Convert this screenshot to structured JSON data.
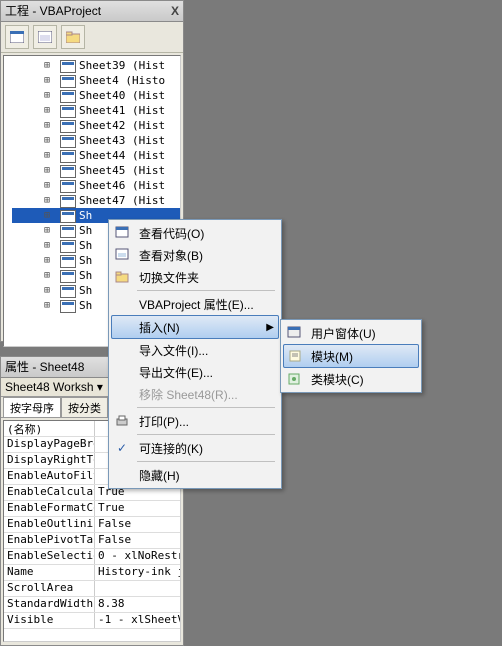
{
  "project_panel": {
    "title": "工程 - VBAProject",
    "close": "X",
    "tree": [
      {
        "label": "Sheet39 (Hist",
        "sel": false,
        "scroll": "^"
      },
      {
        "label": "Sheet4 (Histo",
        "sel": false
      },
      {
        "label": "Sheet40 (Hist",
        "sel": false
      },
      {
        "label": "Sheet41 (Hist",
        "sel": false
      },
      {
        "label": "Sheet42 (Hist",
        "sel": false
      },
      {
        "label": "Sheet43 (Hist",
        "sel": false
      },
      {
        "label": "Sheet44 (Hist",
        "sel": false
      },
      {
        "label": "Sheet45 (Hist",
        "sel": false
      },
      {
        "label": "Sheet46 (Hist",
        "sel": false
      },
      {
        "label": "Sheet47 (Hist",
        "sel": false
      },
      {
        "label": "Sh",
        "sel": true
      },
      {
        "label": "Sh",
        "sel": false
      },
      {
        "label": "Sh",
        "sel": false
      },
      {
        "label": "Sh",
        "sel": false
      },
      {
        "label": "Sh",
        "sel": false
      },
      {
        "label": "Sh",
        "sel": false
      },
      {
        "label": "Sh",
        "sel": false
      }
    ]
  },
  "props_panel": {
    "title": "属性 - Sheet48",
    "header": "Sheet48 Worksh",
    "tabs": [
      "按字母序",
      "按分类"
    ],
    "rows": [
      {
        "k": "(名称)",
        "v": ""
      },
      {
        "k": "DisplayPageBre",
        "v": ""
      },
      {
        "k": "DisplayRightTo",
        "v": ""
      },
      {
        "k": "EnableAutoFilt",
        "v": ""
      },
      {
        "k": "EnableCalculat",
        "v": "True"
      },
      {
        "k": "EnableFormatCo",
        "v": "True"
      },
      {
        "k": "EnableOutlinin",
        "v": "False"
      },
      {
        "k": "EnablePivotTab",
        "v": "False"
      },
      {
        "k": "EnableSelectio",
        "v": "0 - xlNoRestr"
      },
      {
        "k": "Name",
        "v": "History-ink j"
      },
      {
        "k": "ScrollArea",
        "v": ""
      },
      {
        "k": "StandardWidth",
        "v": "8.38"
      },
      {
        "k": "Visible",
        "v": "-1 - xlSheetV"
      }
    ]
  },
  "ctx1": {
    "items": [
      {
        "ic": "code",
        "label": "查看代码(O)"
      },
      {
        "ic": "obj",
        "label": "查看对象(B)"
      },
      {
        "ic": "fold",
        "label": "切换文件夹"
      },
      {
        "sep": true
      },
      {
        "label": "VBAProject 属性(E)..."
      },
      {
        "label": "插入(N)",
        "sub": true,
        "hov": true
      },
      {
        "label": "导入文件(I)..."
      },
      {
        "label": "导出文件(E)..."
      },
      {
        "label": "移除 Sheet48(R)...",
        "dis": true
      },
      {
        "sep": true
      },
      {
        "ic": "print",
        "label": "打印(P)..."
      },
      {
        "sep": true
      },
      {
        "chk": true,
        "label": "可连接的(K)"
      },
      {
        "sep": true
      },
      {
        "label": "隐藏(H)"
      }
    ]
  },
  "ctx2": {
    "items": [
      {
        "ic": "form",
        "label": "用户窗体(U)"
      },
      {
        "ic": "mod",
        "label": "模块(M)",
        "hov": true
      },
      {
        "ic": "cls",
        "label": "类模块(C)"
      }
    ]
  }
}
